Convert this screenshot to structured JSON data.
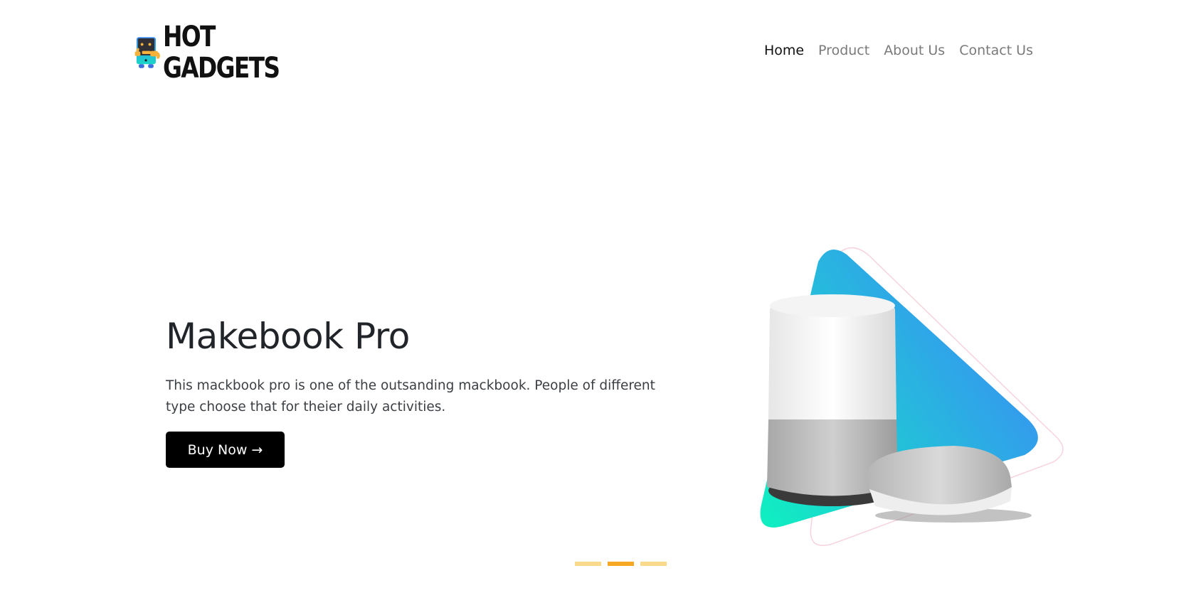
{
  "brand": {
    "line1": "HOT",
    "line2": "GADGETS"
  },
  "nav": {
    "items": [
      {
        "label": "Home",
        "active": true
      },
      {
        "label": "Product",
        "active": false
      },
      {
        "label": "About Us",
        "active": false
      },
      {
        "label": "Contact Us",
        "active": false
      }
    ]
  },
  "hero": {
    "title": "Makebook Pro",
    "description": "This mackbook pro is one of the outsanding mackbook. People of different type choose that for theier daily activities.",
    "button_label": "Buy Now →",
    "image": "smart-speakers-image"
  },
  "carousel": {
    "slide_count": 3,
    "active_index": 1
  },
  "colors": {
    "accent": "#f7a823",
    "indicator_inactive": "#f9d98b",
    "button_bg": "#000000",
    "gradient_start": "#0ff0c0",
    "gradient_end": "#3a8cf5"
  }
}
